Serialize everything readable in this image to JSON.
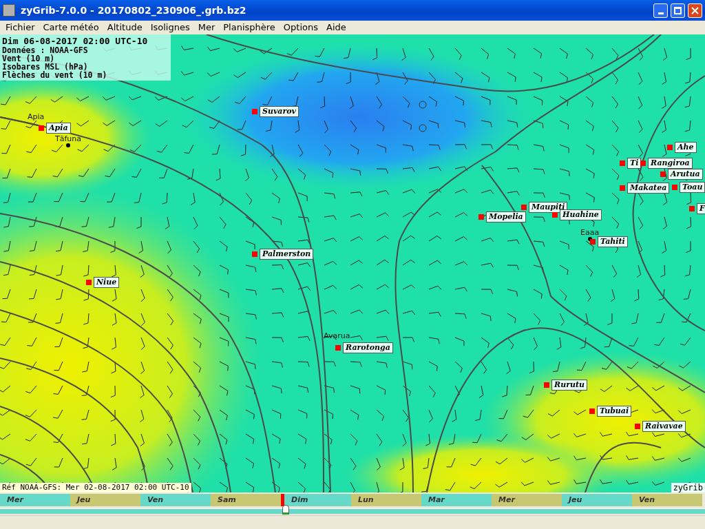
{
  "window": {
    "title": "zyGrib-7.0.0 - 20170802_230906_.grb.bz2"
  },
  "menu": [
    "Fichier",
    "Carte météo",
    "Altitude",
    "Isolignes",
    "Mer",
    "Planisphère",
    "Options",
    "Aide"
  ],
  "info": {
    "date": "Dim 06-08-2017 02:00 UTC-10",
    "lines": [
      "Données : NOAA-GFS",
      "Vent (10 m)",
      "Isobares MSL (hPa)",
      "Flèches du vent (10 m)"
    ]
  },
  "cities": [
    {
      "name": "Suvarov"
    },
    {
      "name": "Apia"
    },
    {
      "name": "Ahe"
    },
    {
      "name": "Ti"
    },
    {
      "name": "Rangiroa"
    },
    {
      "name": "Arutua"
    },
    {
      "name": "Makatea"
    },
    {
      "name": "Toau"
    },
    {
      "name": "Maupiti"
    },
    {
      "name": "F"
    },
    {
      "name": "Huahine"
    },
    {
      "name": "Mopelia"
    },
    {
      "name": "Tahiti"
    },
    {
      "name": "Palmerston"
    },
    {
      "name": "Niue"
    },
    {
      "name": "Rarotonga"
    },
    {
      "name": "Rurutu"
    },
    {
      "name": "Tubuai"
    },
    {
      "name": "Raivavae"
    }
  ],
  "places": [
    {
      "name": "Apia"
    },
    {
      "name": "Tāfuna"
    },
    {
      "name": "Eaaa"
    },
    {
      "name": "Avarua"
    }
  ],
  "reference": "Réf NOAA-GFS: Mer 02-08-2017 02:00 UTC-10",
  "brand": "zyGrib",
  "timeline": {
    "level": 0.4,
    "days": [
      {
        "label": "Mer",
        "selected": false
      },
      {
        "label": "Jeu",
        "selected": false
      },
      {
        "label": "Ven",
        "selected": false
      },
      {
        "label": "Sam",
        "selected": false
      },
      {
        "label": "Dim",
        "selected": true
      },
      {
        "label": "Lun",
        "selected": false
      },
      {
        "label": "Mar",
        "selected": false
      },
      {
        "label": "Mer",
        "selected": false
      },
      {
        "label": "Jeu",
        "selected": false
      },
      {
        "label": "Ven",
        "selected": false
      }
    ]
  }
}
